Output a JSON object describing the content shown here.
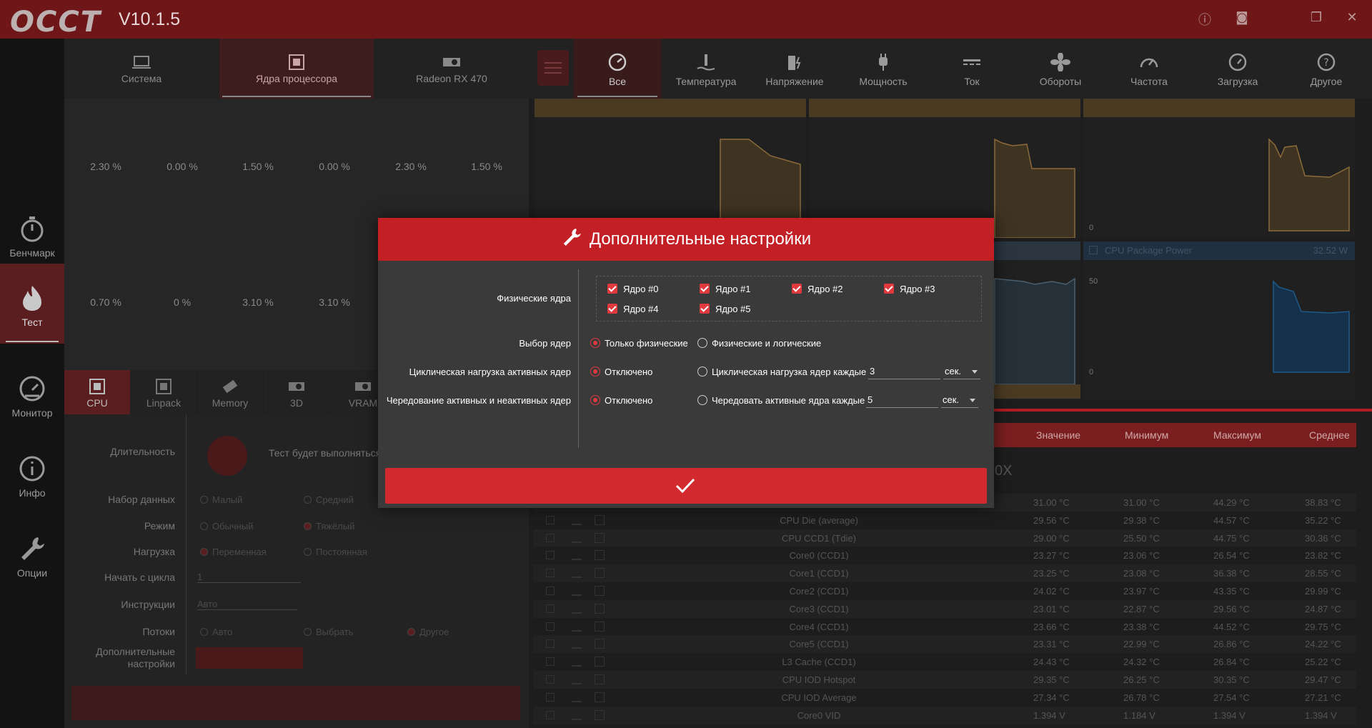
{
  "app": {
    "logo": "OCCT",
    "version": "V10.1.5"
  },
  "left_nav": [
    {
      "label": "Бенчмарк",
      "icon": "stopwatch-icon"
    },
    {
      "label": "Тест",
      "icon": "flame-icon"
    },
    {
      "label": "Монитор",
      "icon": "gauge-icon"
    },
    {
      "label": "Инфо",
      "icon": "info-icon"
    },
    {
      "label": "Опции",
      "icon": "wrench-icon"
    }
  ],
  "left_tabs": [
    "Система",
    "Ядра процессора",
    "Radeon RX 470"
  ],
  "core_loads_row1": [
    "2.30 %",
    "0.00 %",
    "1.50 %",
    "0.00 %",
    "2.30 %",
    "1.50 %"
  ],
  "core_loads_row2": [
    "0.70 %",
    "0 %",
    "3.10 %",
    "3.10 %"
  ],
  "test_tabs": [
    "CPU",
    "Linpack",
    "Memory",
    "3D",
    "VRAM"
  ],
  "settings": {
    "duration_label": "Длительность",
    "duration_text": "Тест будет выполняться",
    "dataset_label": "Набор данных",
    "dataset_opts": [
      "Малый",
      "Средний"
    ],
    "mode_label": "Режим",
    "mode_opts": [
      "Обычный",
      "Тяжёлый"
    ],
    "load_label": "Нагрузка",
    "load_opts": [
      "Переменная",
      "Постоянная"
    ],
    "start_cycle_label": "Начать с цикла",
    "start_cycle_value": "1",
    "instructions_label": "Инструкции",
    "instructions_value": "Авто",
    "threads_label": "Потоки",
    "threads_opts": [
      "Авто",
      "Выбрать",
      "Другое"
    ],
    "advanced_label_1": "Дополнительные",
    "advanced_label_2": "настройки"
  },
  "right_tabs": [
    "Все",
    "Температура",
    "Напряжение",
    "Мощность",
    "Ток",
    "Обороты",
    "Частота",
    "Загрузка",
    "Другое"
  ],
  "charts": {
    "package_power_title": "CPU Package Power",
    "package_power_value": "32.52 W",
    "axis_0": "0",
    "axis_50": "50"
  },
  "table": {
    "headers": [
      "Значение",
      "Минимум",
      "Максимум",
      "Среднее"
    ],
    "group_suffix": "0X",
    "rows": [
      {
        "name": "",
        "v": "31.00 °C",
        "min": "31.00 °C",
        "max": "44.29 °C",
        "avg": "38.83 °C"
      },
      {
        "name": "CPU Die (average)",
        "v": "29.56 °C",
        "min": "29.38 °C",
        "max": "44.57 °C",
        "avg": "35.22 °C"
      },
      {
        "name": "CPU CCD1 (Tdie)",
        "v": "29.00 °C",
        "min": "25.50 °C",
        "max": "44.75 °C",
        "avg": "30.36 °C"
      },
      {
        "name": "Core0 (CCD1)",
        "v": "23.27 °C",
        "min": "23.06 °C",
        "max": "26.54 °C",
        "avg": "23.82 °C"
      },
      {
        "name": "Core1 (CCD1)",
        "v": "23.25 °C",
        "min": "23.08 °C",
        "max": "36.38 °C",
        "avg": "28.55 °C"
      },
      {
        "name": "Core2 (CCD1)",
        "v": "24.02 °C",
        "min": "23.97 °C",
        "max": "43.35 °C",
        "avg": "29.99 °C"
      },
      {
        "name": "Core3 (CCD1)",
        "v": "23.01 °C",
        "min": "22.87 °C",
        "max": "29.56 °C",
        "avg": "24.87 °C"
      },
      {
        "name": "Core4 (CCD1)",
        "v": "23.66 °C",
        "min": "23.38 °C",
        "max": "44.52 °C",
        "avg": "29.75 °C"
      },
      {
        "name": "Core5 (CCD1)",
        "v": "23.31 °C",
        "min": "22.99 °C",
        "max": "26.86 °C",
        "avg": "24.22 °C"
      },
      {
        "name": "L3 Cache (CCD1)",
        "v": "24.43 °C",
        "min": "24.32 °C",
        "max": "26.84 °C",
        "avg": "25.22 °C"
      },
      {
        "name": "CPU IOD Hotspot",
        "v": "29.35 °C",
        "min": "26.25 °C",
        "max": "30.35 °C",
        "avg": "29.47 °C"
      },
      {
        "name": "CPU IOD Average",
        "v": "27.34 °C",
        "min": "26.78 °C",
        "max": "27.54 °C",
        "avg": "27.21 °C"
      },
      {
        "name": "Core0 VID",
        "v": "1.394 V",
        "min": "1.184 V",
        "max": "1.394 V",
        "avg": "1.394 V"
      }
    ]
  },
  "modal": {
    "title": "Дополнительные настройки",
    "physical_cores_label": "Физические ядра",
    "cores": [
      "Ядро #0",
      "Ядро #1",
      "Ядро #2",
      "Ядро #3",
      "Ядро #4",
      "Ядро #5"
    ],
    "core_selection_label": "Выбор ядер",
    "core_selection_opts": [
      "Только физические",
      "Физические и логические"
    ],
    "cyclic_label": "Циклическая нагрузка активных ядер",
    "cyclic_off": "Отключено",
    "cyclic_on": "Циклическая нагрузка ядер каждые",
    "cyclic_value": "3",
    "cyclic_unit": "сек.",
    "alternate_label": "Чередование активных и неактивных ядер",
    "alternate_off": "Отключено",
    "alternate_on": "Чередовать активные ядра каждые",
    "alternate_value": "5",
    "alternate_unit": "сек.",
    "accent": "#c32026"
  }
}
